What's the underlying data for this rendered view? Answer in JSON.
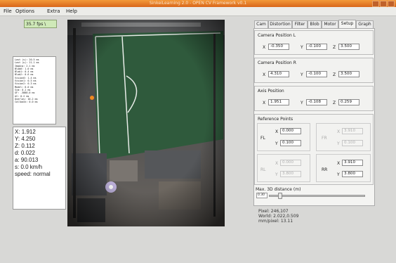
{
  "window": {
    "title": "SinkeiLearning 2.0 - OPEN CV Framework v0.1"
  },
  "menu": [
    "File",
    "Options",
    "Extra",
    "Help"
  ],
  "fps_label": "35.7 fps \\",
  "stats_rows": [
    "Last (s):    20.5 ms",
    "Last (u):    21.1 ms",
    "  ImgAcq:     2.1 ms",
    "Blob0:        1.0 ms",
    "Blob1:        0.4 ms",
    "Blob2:        0.6 ms",
    "Vision0:      1.4 ms",
    "Vision1:      0.5 ms",
    "Vision2:      0.3 ms",
    "Model:        0.0 ms",
    "Sim:          0.1 ms",
    "GF:       -3888.0 ms",
    "AI:           0.2 ms",
    "Overlay:     10.2 ms",
    "Callback:     0.0 ms"
  ],
  "position": {
    "x": "X: 1.912",
    "y": "Y: 4.250",
    "z": "Z: 0.112",
    "d": "d: 0.022",
    "a": "a: 90.013",
    "s": "s:   0.0 km/h",
    "speed": "speed: normal"
  },
  "tabs": [
    "Cam",
    "Distortion",
    "Filter",
    "Blob",
    "Motor",
    "Setup",
    "Graph"
  ],
  "active_tab": "Setup",
  "camera_l": {
    "title": "Camera Position L",
    "x": "-0.350",
    "y": "-0.100",
    "z": "3.500"
  },
  "camera_r": {
    "title": "Camera Position R",
    "x": "4.310",
    "y": "-0.100",
    "z": "3.500"
  },
  "axis": {
    "title": "Axis Position",
    "x": "1.951",
    "y": "-0.108",
    "z": "0.259"
  },
  "axis_letters": {
    "x": "X",
    "y": "Y",
    "z": "Z"
  },
  "ref": {
    "title": "Reference Points",
    "fl": {
      "label": "FL",
      "x": "0.000",
      "y": "0.100"
    },
    "fr": {
      "label": "FR",
      "x": "3.910",
      "y": "0.100"
    },
    "rl": {
      "label": "RL",
      "x": "0.000",
      "y": "3.800"
    },
    "rr": {
      "label": "RR",
      "x": "3.910",
      "y": "3.800"
    }
  },
  "max3d": {
    "title": "Max. 3D distance (m)",
    "value": "0.30",
    "fraction": 0.1
  },
  "pixel_info": {
    "pixel": "Pixel: 246,107",
    "world": "World: 2.022,0.509",
    "mm": "mm/pixel: 13.11"
  },
  "colors": {
    "titlebar": "#e07a2a",
    "field_green": "#2f5a3c",
    "fps_green": "#cfe9b8",
    "ball_orange": "#f08a20"
  }
}
